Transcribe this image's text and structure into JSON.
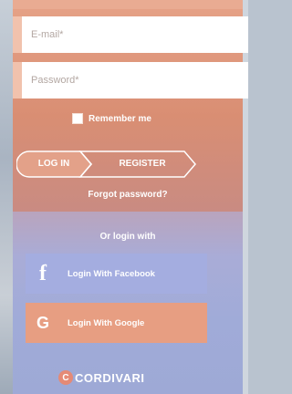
{
  "form": {
    "email_placeholder": "E-mail*",
    "password_placeholder": "Password*",
    "remember_label": "Remember me",
    "login_tab": "LOG IN",
    "register_tab": "REGISTER",
    "forgot_link": "Forgot password?",
    "or_label": "Or login with"
  },
  "social": {
    "facebook_label": "Login With Facebook",
    "google_label": "Login With Google",
    "facebook_icon": "f",
    "google_icon": "G"
  },
  "brand": {
    "name": "CORDIVARI",
    "primary_color": "#e6a287",
    "secondary_color": "#a0abd8"
  }
}
